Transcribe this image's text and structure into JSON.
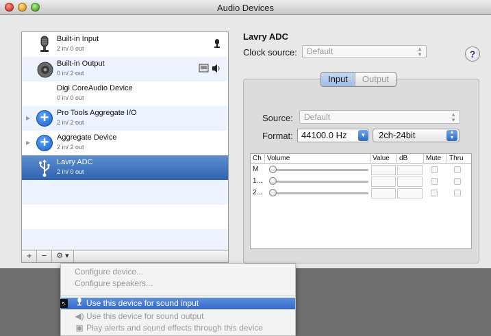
{
  "window": {
    "title": "Audio Devices"
  },
  "devices": [
    {
      "name": "Built-in Input",
      "sub": "2 in/ 0 out",
      "icon": "microphone-icon",
      "right_icon": "mic-indicator-icon"
    },
    {
      "name": "Built-in Output",
      "sub": "0 in/ 2 out",
      "icon": "speaker-icon",
      "right_icon": "alert-output-speaker-icon"
    },
    {
      "name": "Digi CoreAudio Device",
      "sub": "0 in/ 0 out",
      "icon": ""
    },
    {
      "name": "Pro Tools Aggregate I/O",
      "sub": "2 in/ 2 out",
      "icon": "aggregate-plus-icon"
    },
    {
      "name": "Aggregate Device",
      "sub": "2 in/ 2 out",
      "icon": "aggregate-plus-icon"
    },
    {
      "name": "Lavry ADC",
      "sub": "2 in/ 0 out",
      "icon": "usb-icon",
      "selected": true
    }
  ],
  "toolbar": {
    "add": "+",
    "remove": "−",
    "gear": "⚙ ▾"
  },
  "detail": {
    "device_title": "Lavry ADC",
    "clock_label": "Clock source:",
    "clock_value": "Default",
    "help": "?",
    "tabs": [
      {
        "label": "Input",
        "active": true
      },
      {
        "label": "Output",
        "active": false
      }
    ],
    "source_label": "Source:",
    "source_value": "Default",
    "format_label": "Format:",
    "format_rate": "44100.0 Hz",
    "format_bits": "2ch-24bit"
  },
  "volume_table": {
    "headers": {
      "ch": "Ch",
      "volume": "Volume",
      "value": "Value",
      "db": "dB",
      "mute": "Mute",
      "thru": "Thru"
    },
    "rows": [
      {
        "ch": "M"
      },
      {
        "ch": "1..."
      },
      {
        "ch": "2..."
      }
    ]
  },
  "menu": {
    "items": [
      {
        "label": "Configure device...",
        "enabled": false
      },
      {
        "label": "Configure speakers...",
        "enabled": false
      },
      {
        "label": "Use this device for sound input",
        "highlighted": true,
        "icon": "microphone-icon"
      },
      {
        "label": "Use this device for sound output",
        "enabled": false,
        "icon": "speaker-icon"
      },
      {
        "label": "Play alerts and sound effects through this device",
        "enabled": false,
        "icon": "alert-icon"
      }
    ]
  },
  "colors": {
    "selection": "#3a6fc0",
    "alt_row": "#edf3fe",
    "menu_highlight": "#3f74cc"
  }
}
